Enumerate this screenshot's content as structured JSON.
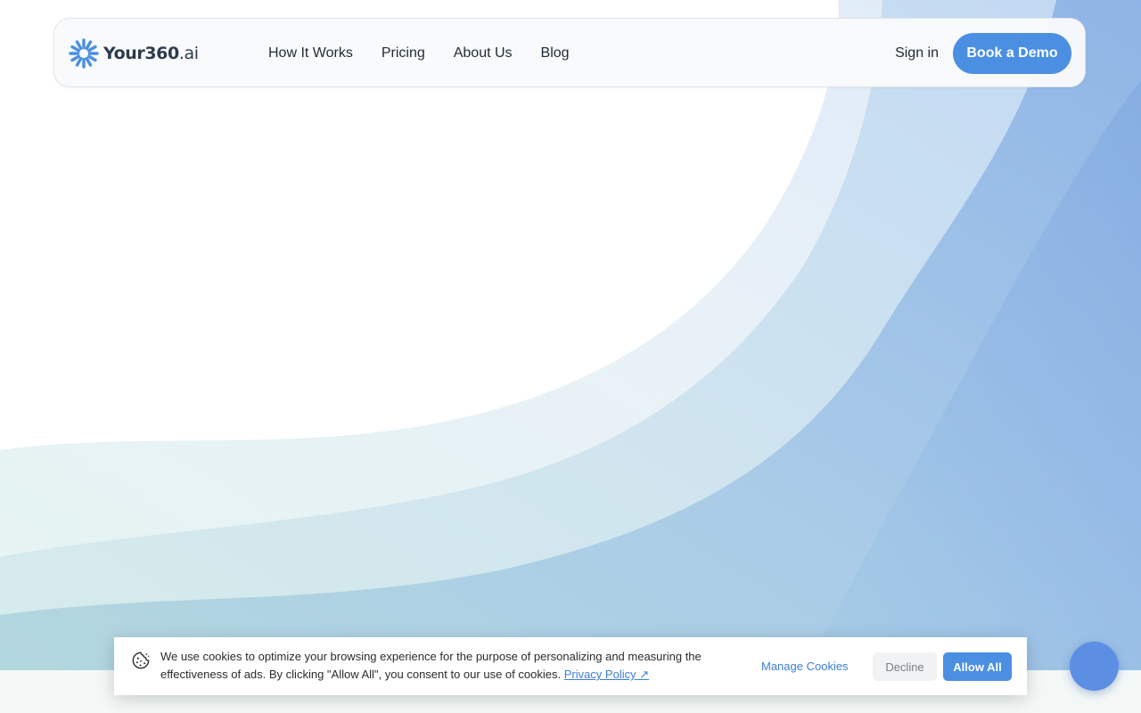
{
  "brand": {
    "name": "Your360",
    "suffix": ".ai",
    "icon": "burst-logo-icon",
    "accent_color": "#4a8fe2"
  },
  "nav": {
    "items": [
      {
        "label": "How It Works"
      },
      {
        "label": "Pricing"
      },
      {
        "label": "About Us"
      },
      {
        "label": "Blog"
      }
    ],
    "sign_in": "Sign in",
    "cta": "Book a Demo"
  },
  "cookie_banner": {
    "icon": "cookie-icon",
    "message": "We use cookies to optimize your browsing experience for the purpose of personalizing and measuring the effectiveness of ads. By clicking \"Allow All\", you consent to our use of cookies.",
    "privacy_link": "Privacy Policy ↗",
    "manage": "Manage Cookies",
    "decline": "Decline",
    "allow": "Allow All"
  },
  "chat_widget": {
    "icon": "chat-bubble-icon",
    "color": "#5c8fe3"
  },
  "background": {
    "colors": [
      "#e6f4f1",
      "#d4e8ee",
      "#a9cbe6",
      "#7fa8df"
    ]
  }
}
